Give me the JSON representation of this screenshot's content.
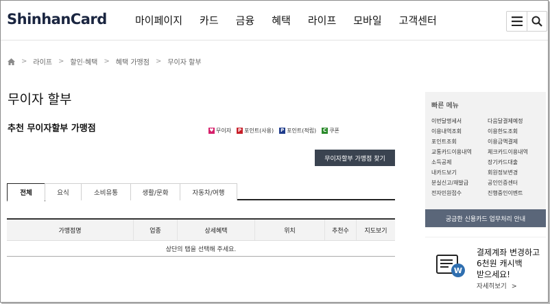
{
  "header": {
    "logo": "ShinhanCard",
    "nav": [
      "마이페이지",
      "카드",
      "금융",
      "혜택",
      "라이프",
      "모바일",
      "고객센터"
    ]
  },
  "breadcrumb": [
    "라이프",
    "할인·혜택",
    "혜택 가맹점",
    "무이자 할부"
  ],
  "page_title": "무이자 할부",
  "section_title": "추천 무이자할부 가맹점",
  "legend": [
    {
      "mark": "♥",
      "label": "무이자",
      "color": "#d6206b"
    },
    {
      "mark": "P",
      "label": "포인트(사용)",
      "color": "#c8202a"
    },
    {
      "mark": "P",
      "label": "포인트(적립)",
      "color": "#1f3c8c"
    },
    {
      "mark": "C",
      "label": "쿠폰",
      "color": "#2a8a2a"
    }
  ],
  "find_button": "무이자할부 가맹점 찾기",
  "tabs": [
    "전체",
    "요식",
    "소비유통",
    "생활/문화",
    "자동차/여행"
  ],
  "table": {
    "headers": [
      "가맹점명",
      "업종",
      "상세혜택",
      "위치",
      "추천수",
      "지도보기"
    ],
    "empty_message": "상단의 탭을 선택해 주세요."
  },
  "quick_menu": {
    "title": "빠른 메뉴",
    "items": [
      "이번달명세서",
      "다음달결제예정",
      "이용내역조회",
      "이용한도조회",
      "포인트조회",
      "이용금액결제",
      "교통카드이용내역",
      "체크카드이용내역",
      "소득공제",
      "장기카드대출",
      "내카드보기",
      "회원정보변경",
      "분실신고/재발급",
      "공인인증센터",
      "전자민원접수",
      "진행중인이벤트"
    ],
    "footer": "궁금한 신용카드 업무처리 안내"
  },
  "promo": {
    "line1": "결제계좌 변경하고",
    "line2": "6천원 캐시백",
    "line3": "받으세요!",
    "link": "자세히보기",
    "badge": "W"
  }
}
